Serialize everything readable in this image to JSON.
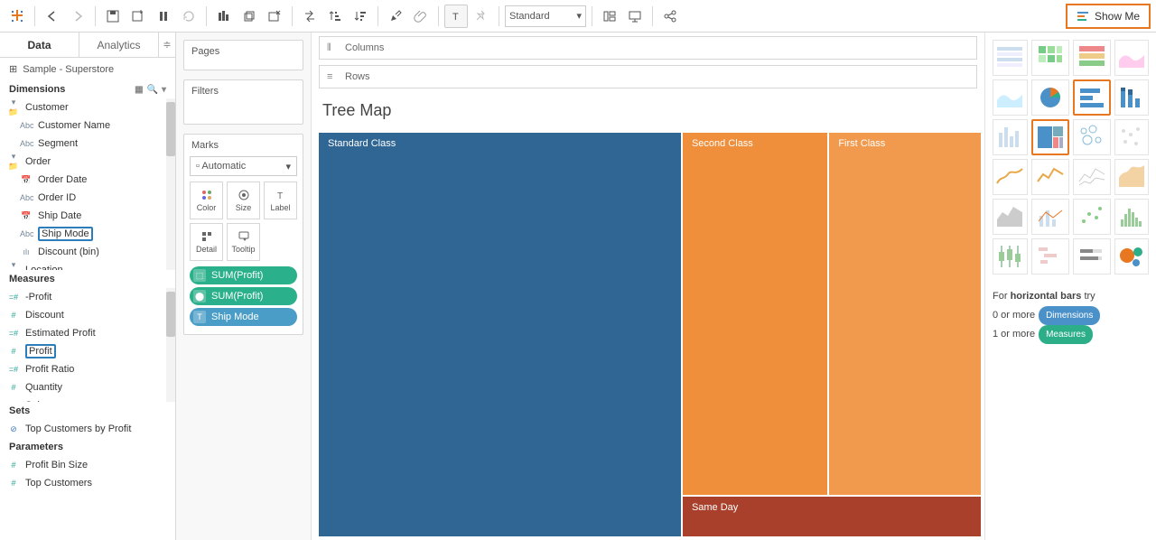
{
  "toolbar": {
    "style_select": "Standard",
    "showme_label": "Show Me"
  },
  "data_panel": {
    "tabs": {
      "data": "Data",
      "analytics": "Analytics"
    },
    "datasource": "Sample - Superstore",
    "dimensions_label": "Dimensions",
    "measures_label": "Measures",
    "sets_label": "Sets",
    "parameters_label": "Parameters",
    "dim_groups": {
      "customer": "Customer",
      "customer_name": "Customer Name",
      "segment": "Segment",
      "order": "Order",
      "order_date": "Order Date",
      "order_id": "Order ID",
      "ship_date": "Ship Date",
      "ship_mode": "Ship Mode",
      "discount_bin": "Discount (bin)",
      "location": "Location"
    },
    "measures": {
      "neg_profit": "-Profit",
      "discount": "Discount",
      "estimated_profit": "Estimated Profit",
      "profit": "Profit",
      "profit_ratio": "Profit Ratio",
      "quantity": "Quantity",
      "sales": "Sales"
    },
    "sets": {
      "top_customers": "Top Customers by Profit"
    },
    "parameters": {
      "profit_bin_size": "Profit Bin Size",
      "top_customers": "Top Customers"
    }
  },
  "shelves": {
    "pages": "Pages",
    "filters": "Filters",
    "marks": "Marks",
    "mark_type": "Automatic",
    "color": "Color",
    "size": "Size",
    "label": "Label",
    "detail": "Detail",
    "tooltip": "Tooltip",
    "pill_sum_profit": "SUM(Profit)",
    "pill_ship_mode": "Ship Mode"
  },
  "canvas": {
    "columns": "Columns",
    "rows": "Rows",
    "title": "Tree Map",
    "tm": {
      "standard": "Standard Class",
      "second": "Second Class",
      "first": "First Class",
      "sameday": "Same Day"
    }
  },
  "showme": {
    "hint_prefix": "For ",
    "hint_bold": "horizontal bars",
    "hint_suffix": " try",
    "dim_line": "0 or more",
    "dim_chip": "Dimensions",
    "meas_line": "1 or more",
    "meas_chip": "Measures"
  },
  "chart_data": {
    "type": "treemap",
    "title": "Tree Map",
    "dimension": "Ship Mode",
    "measure": "SUM(Profit)",
    "series": [
      {
        "name": "Standard Class",
        "value_share": 0.55,
        "color": "#2f6694"
      },
      {
        "name": "Second Class",
        "value_share": 0.21,
        "color": "#ef8f3b"
      },
      {
        "name": "First Class",
        "value_share": 0.18,
        "color": "#f19a4d"
      },
      {
        "name": "Same Day",
        "value_share": 0.06,
        "color": "#a8402b"
      }
    ]
  }
}
